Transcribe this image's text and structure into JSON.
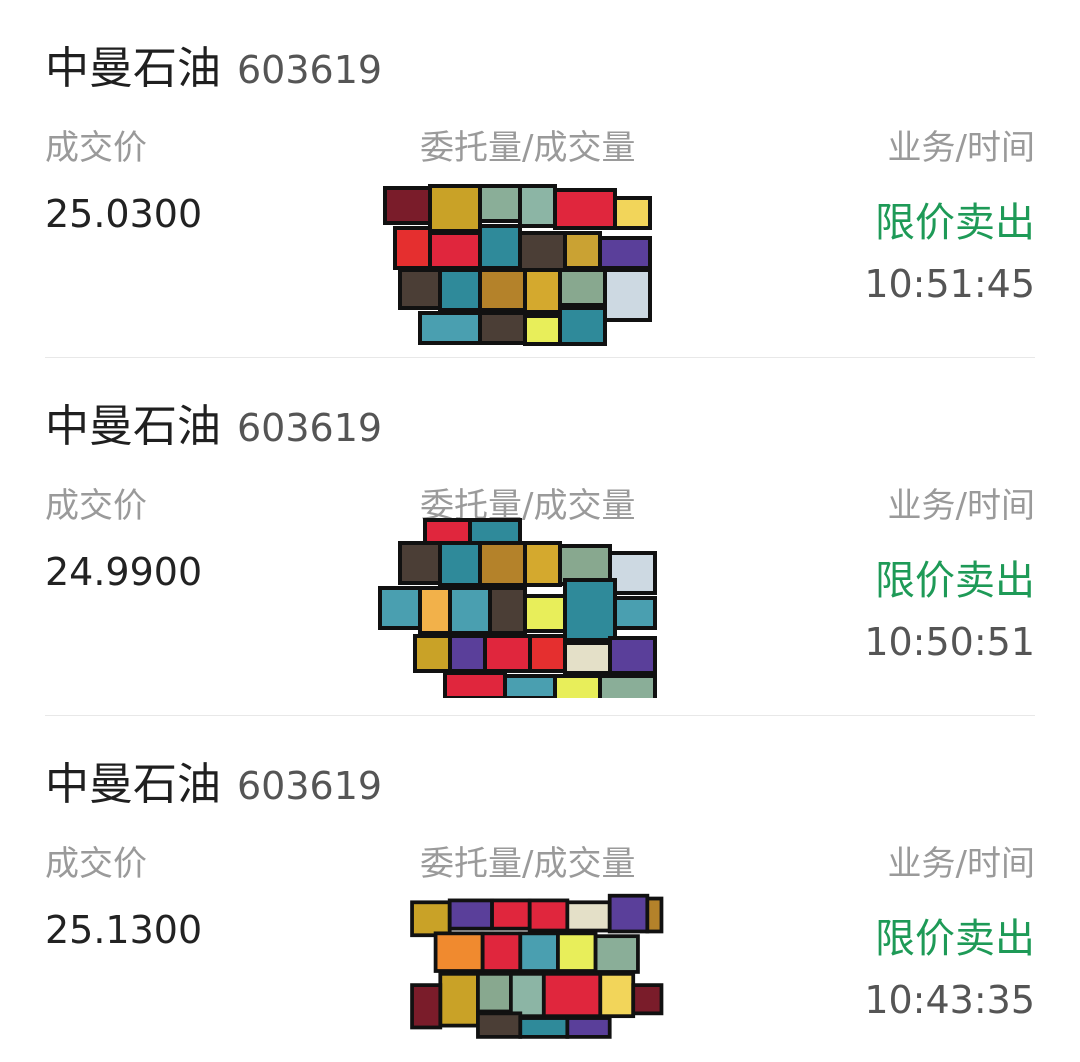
{
  "trades": [
    {
      "stock_name": "中曼石油",
      "stock_code": "603619",
      "price_label": "成交价",
      "qty_label": "委托量/成交量",
      "biz_label": "业务/时间",
      "price": "25.0300",
      "order_type": "限价卖出",
      "time": "10:51:45",
      "order_type_color": "#1e9a57"
    },
    {
      "stock_name": "中曼石油",
      "stock_code": "603619",
      "price_label": "成交价",
      "qty_label": "委托量/成交量",
      "biz_label": "业务/时间",
      "price": "24.9900",
      "order_type": "限价卖出",
      "time": "10:50:51",
      "order_type_color": "#1e9a57"
    },
    {
      "stock_name": "中曼石油",
      "stock_code": "603619",
      "price_label": "成交价",
      "qty_label": "委托量/成交量",
      "biz_label": "业务/时间",
      "price": "25.1300",
      "order_type": "限价卖出",
      "time": "10:43:35",
      "order_type_color": "#1e9a57"
    }
  ]
}
